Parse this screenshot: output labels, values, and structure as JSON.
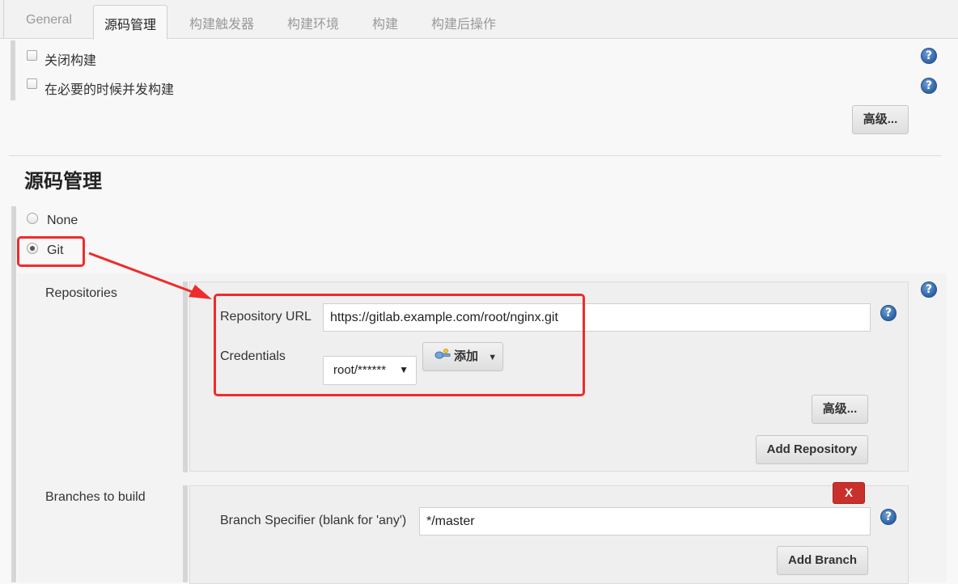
{
  "tabs": [
    {
      "label": "General"
    },
    {
      "label": "源码管理"
    },
    {
      "label": "构建触发器"
    },
    {
      "label": "构建环境"
    },
    {
      "label": "构建"
    },
    {
      "label": "构建后操作"
    }
  ],
  "general": {
    "options": [
      {
        "label": "关闭构建",
        "checked": false
      },
      {
        "label": "在必要的时候并发构建",
        "checked": false
      }
    ],
    "advanced_label": "高级..."
  },
  "scm": {
    "title": "源码管理",
    "options": [
      {
        "label": "None",
        "selected": false
      },
      {
        "label": "Git",
        "selected": true
      }
    ],
    "repositories": {
      "label": "Repositories",
      "url_label": "Repository URL",
      "url_value": "https://gitlab.example.com/root/nginx.git",
      "credentials_label": "Credentials",
      "credentials_value": "root/******",
      "add_label": "添加",
      "advanced_label": "高级...",
      "add_repository_label": "Add Repository"
    },
    "branches": {
      "label": "Branches to build",
      "delete_label": "X",
      "specifier_label": "Branch Specifier (blank for 'any')",
      "specifier_value": "*/master",
      "add_branch_label": "Add Branch"
    }
  },
  "colors": {
    "annotation_red": "#f02b2b",
    "help_blue": "#2e62a6",
    "delete_red": "#c9302c"
  },
  "icons": {
    "help": "help-icon",
    "credentials": "key-icon",
    "dropdown": "caret-down-icon"
  }
}
